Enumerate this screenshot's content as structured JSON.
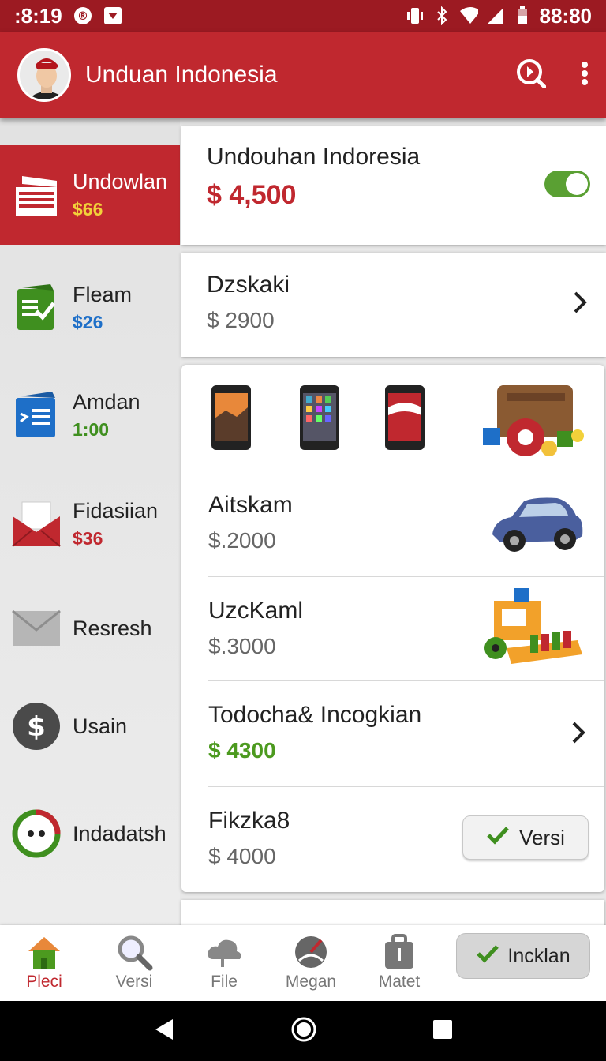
{
  "status_bar": {
    "time": ":8:19",
    "clock_right": "88:80"
  },
  "app_bar": {
    "title": "Unduan Indonesia"
  },
  "sidebar": {
    "items": [
      {
        "label": "Undowlan",
        "sub": "$66",
        "sub_color": "#f2d13a"
      },
      {
        "label": "Fleam",
        "sub": "$26",
        "sub_color": "#1e6fc8"
      },
      {
        "label": "Amdan",
        "sub": "1:00",
        "sub_color": "#3f8f1f"
      },
      {
        "label": "Fidasiian",
        "sub": "$36",
        "sub_color": "#c0282f"
      },
      {
        "label": "Resresh",
        "sub": ""
      },
      {
        "label": "Usain",
        "sub": ""
      },
      {
        "label": "Indadatsh",
        "sub": ""
      }
    ]
  },
  "cards": {
    "top": {
      "title": "Undouhan Indoresia",
      "price": "$ 4,500",
      "toggle_on": true
    },
    "second": {
      "title": "Dzskaki",
      "price": "$ 2900"
    },
    "list": [
      {
        "title": "Aitskam",
        "price": "$.2000",
        "image": "car-image"
      },
      {
        "title": "UzcKaml",
        "price": "$.3000",
        "image": "machine-image"
      },
      {
        "title": "Todocha& Incogkian",
        "price": "$ 4300"
      },
      {
        "title": "Fikzka8",
        "price": "$ 4000",
        "button": "Versi"
      }
    ]
  },
  "bottom_nav": {
    "items": [
      {
        "label": "Pleci"
      },
      {
        "label": "Versi"
      },
      {
        "label": "File"
      },
      {
        "label": "Megan"
      },
      {
        "label": "Matet"
      }
    ],
    "include_button": "Incklan"
  },
  "colors": {
    "brand_red": "#c0282f",
    "dark_red": "#9c1a22",
    "green": "#4c9a1f"
  }
}
